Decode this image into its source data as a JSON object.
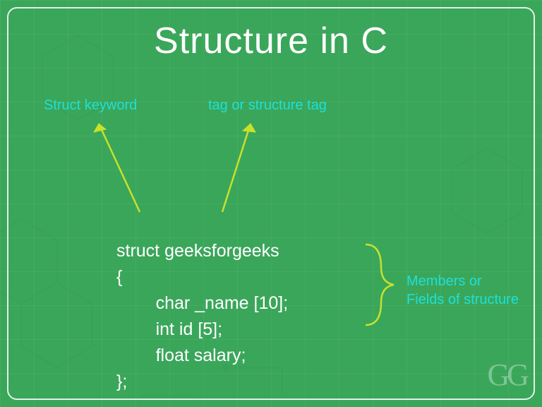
{
  "title": "Structure in C",
  "labels": {
    "keyword": "Struct keyword",
    "tag": "tag or structure tag",
    "members_line1": "Members or",
    "members_line2": "Fields of structure"
  },
  "code": {
    "line1": "struct geeksforgeeks",
    "line2": "{",
    "line3": "        char _name [10];",
    "line4": "        int id [5];",
    "line5": "        float salary;",
    "line6": "};"
  },
  "logo": "GG",
  "colors": {
    "bg": "#3AA65A",
    "accent": "#1EE0D8",
    "arrow": "#C6E22A",
    "text": "#FFFFFF"
  }
}
